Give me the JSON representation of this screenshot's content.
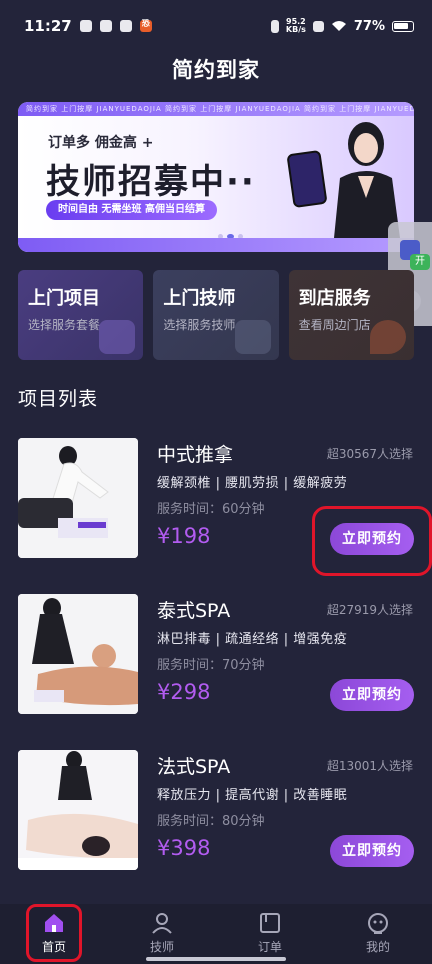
{
  "status_bar": {
    "time": "11:27",
    "app_badge": "恐",
    "network_speed_value": "95.2",
    "network_speed_unit": "KB/s",
    "battery": "77%"
  },
  "page": {
    "title": "简约到家"
  },
  "banner": {
    "strip_text": "简约到家 上门按摩 JIANYUEDAOJIA 简约到家 上门按摩 JIANYUEDAOJIA 简约到家 上门按摩 JIANYUEDAOJIA",
    "sub_text": "订单多 佣金高 +",
    "headline": "技师招募中··",
    "pill_text": "时间自由 无需坐班 高佣当日结算",
    "current_slide": 1,
    "slide_count": 3
  },
  "float_widget": {
    "open_label": "开",
    "close_label": "×"
  },
  "quick_links": [
    {
      "title": "上门项目",
      "subtitle": "选择服务套餐"
    },
    {
      "title": "上门技师",
      "subtitle": "选择服务技师"
    },
    {
      "title": "到店服务",
      "subtitle": "查看周边门店"
    }
  ],
  "section": {
    "title": "项目列表"
  },
  "items": [
    {
      "name": "中式推拿",
      "count": "超30567人选择",
      "tags": "缓解颈椎 | 腰肌劳损 | 缓解疲劳",
      "duration": "服务时间：60分钟",
      "price": "¥198",
      "button": "立即预约"
    },
    {
      "name": "泰式SPA",
      "count": "超27919人选择",
      "tags": "淋巴排毒 | 疏通经络 | 增强免疫",
      "duration": "服务时间：70分钟",
      "price": "¥298",
      "button": "立即预约"
    },
    {
      "name": "法式SPA",
      "count": "超13001人选择",
      "tags": "释放压力 | 提高代谢 | 改善睡眠",
      "duration": "服务时间：80分钟",
      "price": "¥398",
      "button": "立即预约"
    }
  ],
  "tabbar": {
    "tabs": [
      {
        "label": "首页",
        "icon": "home-icon",
        "active": true
      },
      {
        "label": "技师",
        "icon": "person-icon",
        "active": false
      },
      {
        "label": "订单",
        "icon": "order-icon",
        "active": false
      },
      {
        "label": "我的",
        "icon": "profile-icon",
        "active": false
      }
    ]
  },
  "colors": {
    "background": "#23243a",
    "accent": "#a55ef0",
    "price": "#b25cf0",
    "highlight": "#e0152a"
  }
}
